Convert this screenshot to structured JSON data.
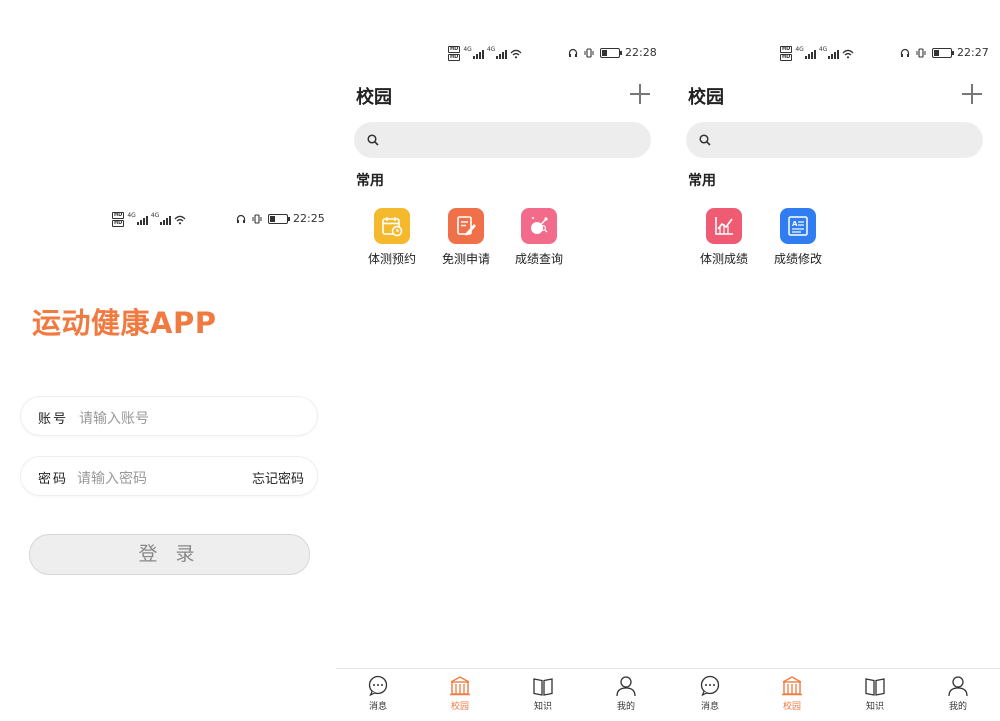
{
  "login_screen": {
    "status": {
      "time": "22:25",
      "net_label": "4G"
    },
    "app_title": "运动健康APP",
    "account": {
      "label": "账号",
      "placeholder": "请输入账号"
    },
    "password": {
      "label": "密码",
      "placeholder": "请输入密码",
      "forgot": "忘记密码"
    },
    "login_button": "登 录"
  },
  "campus_screen_1": {
    "status": {
      "time": "22:28",
      "net_label": "4G"
    },
    "title": "校园",
    "section": "常用",
    "apps": [
      {
        "label": "体测预约",
        "icon": "calendar-clock-icon",
        "color": "#f5b92e"
      },
      {
        "label": "免测申请",
        "icon": "edit-document-icon",
        "color": "#f0704a"
      },
      {
        "label": "成绩查询",
        "icon": "score-search-icon",
        "color": "#f26b8a"
      }
    ],
    "tabs": [
      {
        "label": "消息",
        "icon": "chat-bubble-icon",
        "active": false
      },
      {
        "label": "校园",
        "icon": "campus-building-icon",
        "active": true
      },
      {
        "label": "知识",
        "icon": "open-book-icon",
        "active": false
      },
      {
        "label": "我的",
        "icon": "user-profile-icon",
        "active": false
      }
    ]
  },
  "campus_screen_2": {
    "status": {
      "time": "22:27",
      "net_label": "4G"
    },
    "title": "校园",
    "section": "常用",
    "apps": [
      {
        "label": "体测成绩",
        "icon": "line-chart-icon",
        "color": "#ef5b72"
      },
      {
        "label": "成绩修改",
        "icon": "text-document-icon",
        "color": "#2f7df0"
      }
    ],
    "tabs": [
      {
        "label": "消息",
        "icon": "chat-bubble-icon",
        "active": false
      },
      {
        "label": "校园",
        "icon": "campus-building-icon",
        "active": true
      },
      {
        "label": "知识",
        "icon": "open-book-icon",
        "active": false
      },
      {
        "label": "我的",
        "icon": "user-profile-icon",
        "active": false
      }
    ]
  },
  "colors": {
    "accent": "#f07a40",
    "tab_inactive": "#333333",
    "search_bg": "#ededed"
  }
}
